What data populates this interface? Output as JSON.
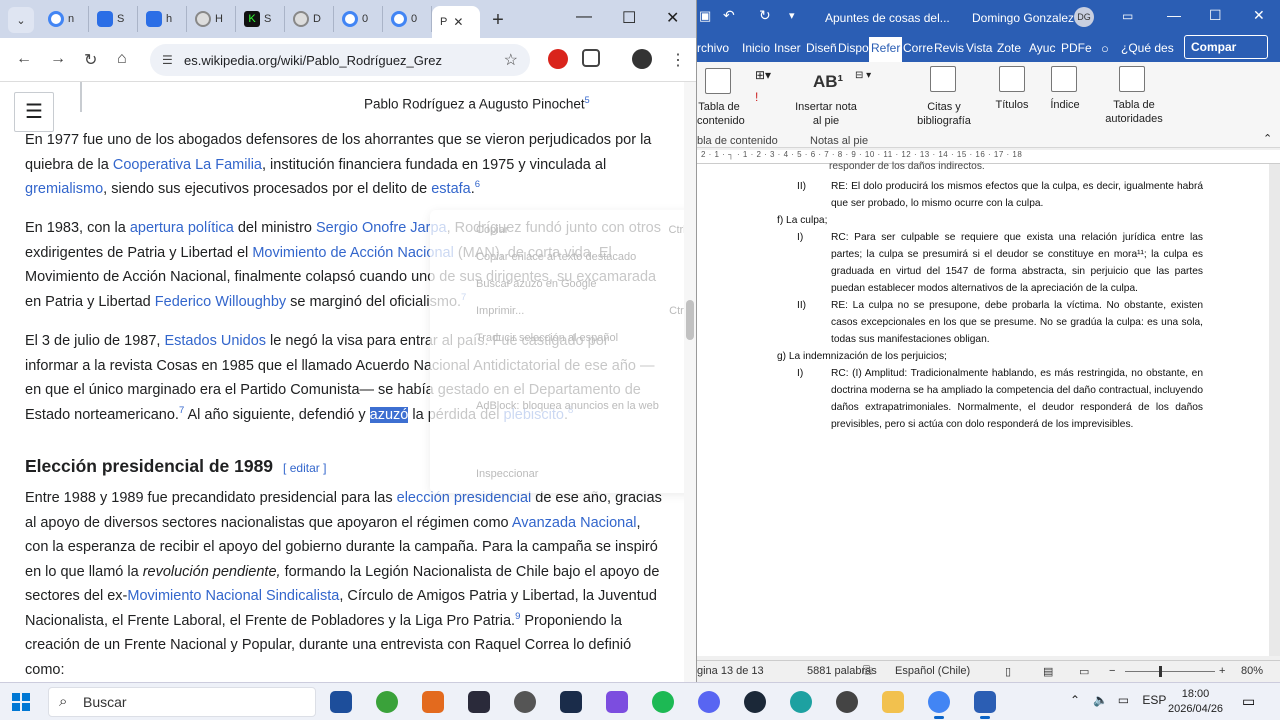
{
  "chrome": {
    "tabs": [
      {
        "label": "n",
        "color": "#4285f4"
      },
      {
        "label": "S",
        "color": "#2b6ee6"
      },
      {
        "label": "h",
        "color": "#2b6ee6"
      },
      {
        "label": "H",
        "color": "#777777"
      },
      {
        "label": "S",
        "color": "#0a0a0a"
      },
      {
        "label": "D",
        "color": "#777777"
      },
      {
        "label": "0",
        "color": "#4285f4"
      },
      {
        "label": "0",
        "color": "#4285f4"
      }
    ],
    "active_tab_label": "P",
    "url": "es.wikipedia.org/wiki/Pablo_Rodríguez_Grez"
  },
  "wiki": {
    "sticky_title": "Pablo Rodríguez a Augusto Pinochet",
    "sticky_ref": "5",
    "p1": {
      "t1": "En 1977 fue uno de los abogados defensores de los ahorrantes que se vieron perjudicados por la quiebra de la ",
      "a1": "Cooperativa La Familia",
      "t2": ", institución financiera fundada en 1975 y vinculada al ",
      "a2": "gremialismo",
      "t3": ", siendo sus ejecutivos procesados por el delito de ",
      "a3": "estafa",
      "ref": "6"
    },
    "p2": {
      "t1": "En 1983, con la ",
      "a1": "apertura política",
      "t2": " del ministro ",
      "a2": "Sergio Onofre Jarpa",
      "t3": ", Rodríguez fundó junto con otros exdirigentes de Patria y Libertad el ",
      "a3": "Movimiento de Acción Nacional",
      "t4": " (MAN), de corta vida. El Movimiento de Acción Nacional, finalmente colapsó cuando uno de sus dirigentes, su excamarada en Patria y Libertad ",
      "a4": "Federico Willoughby",
      "t5": " se marginó del oficialismo.",
      "ref": "7"
    },
    "p3": {
      "t1": "El 3 de julio de 1987, ",
      "a1": "Estados Unidos",
      "t2": " le negó la visa para entrar al país. Fue castigado por informar a la revista Cosas en 1985 que el llamado Acuerdo Nacional Antidictatorial de ese año —en que el único marginado era el Partido Comunista— se había gestado en el Departamento de Estado norteamericano.",
      "ref1": "7",
      "t3": " Al año siguiente, defendió y ",
      "sel": "azuzó",
      "t4": " la pérdida del ",
      "a2": "plebiscito",
      "t5": ".",
      "ref2": "8"
    },
    "section_title": "Elección presidencial de 1989",
    "section_edit": "editar",
    "p4": {
      "t1": "Entre 1988 y 1989 fue precandidato presidencial para las ",
      "a1": "elección presidencial",
      "t2": " de ese año, gracias al apoyo de diversos sectores nacionalistas que apoyaron el régimen como ",
      "a2": "Avanzada Nacional",
      "t3": ", con la esperanza de recibir el apoyo del gobierno durante la campaña. Para la campaña se inspiró en lo que llamó la ",
      "em": "revolución pendiente,",
      "t4": " formando la Legión Nacionalista de Chile bajo el apoyo de sectores del ex-",
      "a3": "Movimiento Nacional Sindicalista",
      "t5": ", Círculo de Amigos Patria y Libertad, la Juventud Nacionalista, el Frente Laboral, el Frente de Pobladores y la Liga Pro Patria.",
      "ref": "9",
      "t6": " Proponiendo la creación de un Frente Nacional y Popular, durante una entrevista con Raquel Correa lo definió como:"
    },
    "context_menu": {
      "copy": "Copiar",
      "copy_shortcut": "Ctrl+C",
      "copy_link": "Copiar enlace al texto destacado",
      "search": "Buscar azuzó en Google",
      "print": "Imprimir...",
      "print_shortcut": "Ctrl+P",
      "translate": "Traducir selección al español",
      "adblock": "AdBlock: bloquea anuncios en la web",
      "inspect": "Inspeccionar"
    }
  },
  "word": {
    "doc_title": "Apuntes de cosas del...",
    "user": "Domingo Gonzalez",
    "avatar": "DG",
    "tabs": [
      "rchivo",
      "Inicio",
      "Inser",
      "Diseñ",
      "Dispo",
      "Refer",
      "Corre",
      "Revis",
      "Vista",
      "Zote",
      "Ayuc",
      "PDFe",
      "¿Qué des"
    ],
    "share": "Compar",
    "ribbon": {
      "toc": "Tabla de contenido",
      "toc_group": "bla de contenido",
      "footnote": "Insertar nota al pie",
      "footnote_group": "Notas al pie",
      "citations": "Citas y bibliografía",
      "captions": "Títulos",
      "index": "Índice",
      "authorities": "Tabla de autoridades"
    },
    "ruler": "2 · 1 · ┐ · 1 · 2 · 3 · 4 · 5 · 6 · 7 · 8 · 9 · 10 · 11 · 12 · 13 · 14 · 15 · 16 · 17 · 18",
    "doc": {
      "top": "responder de los daños indirectos.",
      "ii_num": "II)",
      "ii_text": "RE: El dolo producirá los mismos efectos que la culpa, es decir, igualmente habrá que ser probado, lo mismo ocurre con la culpa.",
      "f_head": "f)   La culpa;",
      "f_i_num": "I)",
      "f_i_text": "RC: Para ser culpable se requiere que exista una relación jurídica entre las partes; la culpa se presumirá si el deudor se constituye en mora¹¹; la culpa es graduada en virtud del 1547 de forma abstracta, sin perjuicio que las partes puedan establecer modos alternativos de la apreciación de la culpa.",
      "f_ii_num": "II)",
      "f_ii_text": "RE: La culpa no se presupone, debe probarla la víctima. No obstante, existen casos excepcionales en los que se presume. No se gradúa la culpa: es una sola, todas sus manifestaciones obligan.",
      "g_head": "g)   La indemnización de los perjuicios;",
      "g_i_num": "I)",
      "g_i_text": "RC: (I) Amplitud: Tradicionalmente hablando, es más restringida, no obstante, en doctrina moderna se ha ampliado la competencia del daño contractual, incluyendo daños extrapatrimoniales. Normalmente, el deudor responderá de los daños previsibles, pero si actúa con dolo responderá de los imprevisibles."
    },
    "status": {
      "page": "gina 13 de 13",
      "words": "5881 palabras",
      "lang": "Español (Chile)",
      "zoom": "80%"
    }
  },
  "taskbar": {
    "search": "Buscar",
    "lang": "ESP",
    "time": "18:00",
    "date": "2026/04/26"
  }
}
